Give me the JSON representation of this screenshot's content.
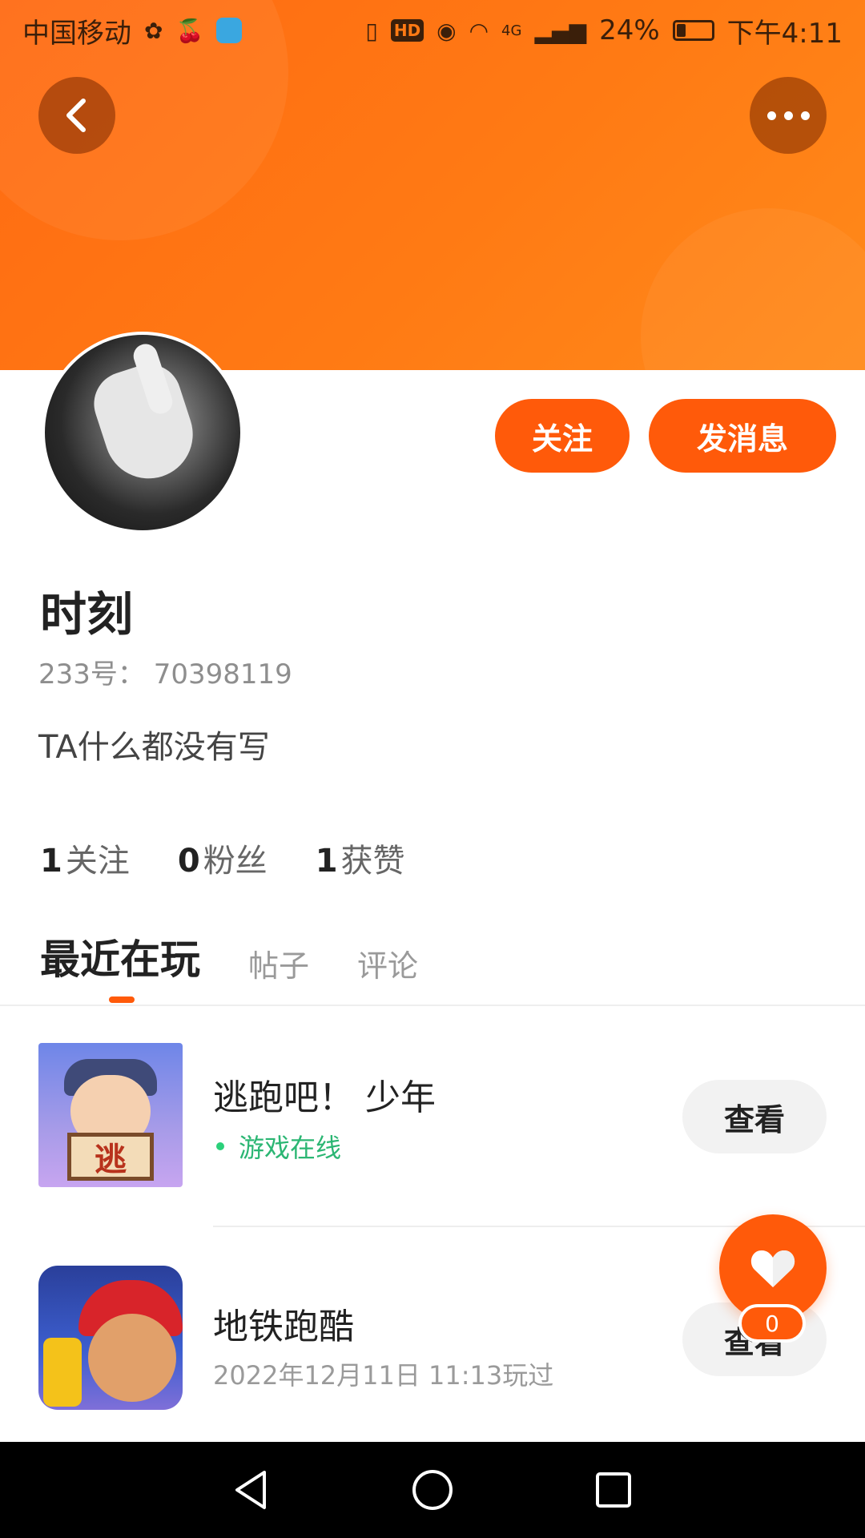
{
  "status_bar": {
    "carrier": "中国移动",
    "network": "4G",
    "battery": "24%",
    "time": "下午4:11",
    "icons": [
      "vibrate-icon",
      "hd-icon",
      "eye-icon",
      "wifi-icon",
      "signal-icon",
      "battery-icon"
    ]
  },
  "header": {
    "back_icon": "back-chevron-icon",
    "more_icon": "more-dots-icon",
    "accent_color": "#ff5a0a"
  },
  "profile": {
    "name": "时刻",
    "id_text": "233号： 70398119",
    "bio": "TA什么都没有写",
    "follow_label": "关注",
    "message_label": "发消息"
  },
  "stats": [
    {
      "count": "1",
      "label": "关注"
    },
    {
      "count": "0",
      "label": "粉丝"
    },
    {
      "count": "1",
      "label": "获赞"
    }
  ],
  "tabs": [
    {
      "label": "最近在玩",
      "active": true
    },
    {
      "label": "帖子",
      "active": false
    },
    {
      "label": "评论",
      "active": false
    }
  ],
  "games": [
    {
      "title": "逃跑吧！ 少年",
      "status": "游戏在线",
      "icon_text": "逃",
      "view_label": "查看"
    },
    {
      "title": "地铁跑酷",
      "status": "2022年12月11日 11:13玩过",
      "view_label": "查看"
    }
  ],
  "like": {
    "count": "0"
  }
}
